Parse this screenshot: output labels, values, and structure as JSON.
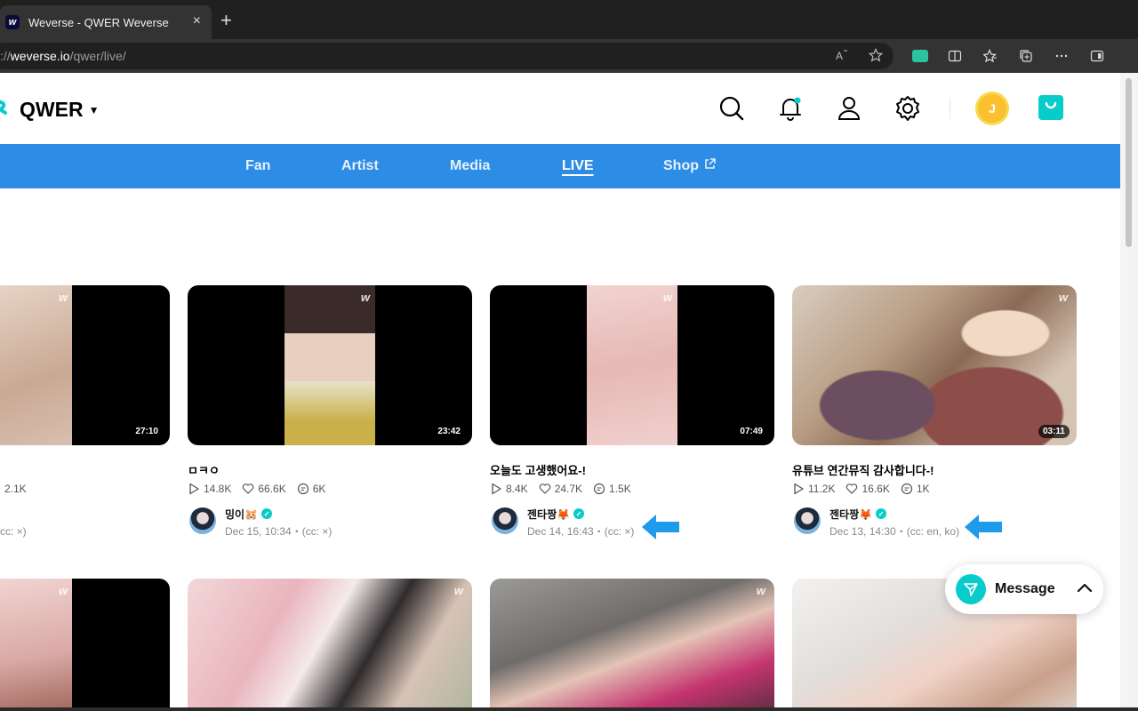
{
  "browser": {
    "tab_title": "Weverse - QWER Weverse",
    "tab_favicon": "w",
    "tab_close": "×",
    "new_tab": "+",
    "url_scheme": "://",
    "url_host": "weverse.io",
    "url_path": "/qwer/live/",
    "icons": [
      "read-aloud-icon",
      "favorite-star-icon",
      "extension-icon",
      "split-screen-icon",
      "favorites-icon",
      "collections-icon",
      "more-icon",
      "sidebar-icon"
    ]
  },
  "header": {
    "community_name": "QWER",
    "jelly_label": "J"
  },
  "nav": {
    "items": [
      {
        "label": "Fan"
      },
      {
        "label": "Artist"
      },
      {
        "label": "Media"
      },
      {
        "label": "LIVE"
      },
      {
        "label": "Shop"
      }
    ]
  },
  "row1": [
    {
      "title": "",
      "plays": "",
      "likes": "",
      "comments": "2.1K",
      "author": "",
      "date": "cc: ×)",
      "duration": "27:10"
    },
    {
      "title": "ㅁㅋㅇ",
      "plays": "14.8K",
      "likes": "66.6K",
      "comments": "6K",
      "author": "밍이🐹",
      "date": "Dec 15, 10:34・(cc: ×)",
      "duration": "23:42"
    },
    {
      "title": "오늘도 고생했어요-!",
      "plays": "8.4K",
      "likes": "24.7K",
      "comments": "1.5K",
      "author": "젠타짱🦊",
      "date": "Dec 14, 16:43・(cc: ×)",
      "duration": "07:49"
    },
    {
      "title": "유튜브 연간뮤직 감사합니다-!",
      "plays": "11.2K",
      "likes": "16.6K",
      "comments": "1K",
      "author": "젠타짱🦊",
      "date": "Dec 13, 14:30・(cc: en, ko)",
      "duration": "03:11"
    }
  ],
  "watermark": "w",
  "message_button": {
    "label": "Message"
  },
  "colors": {
    "nav_bg": "#2d8ce6",
    "accent": "#08ccca",
    "arrow": "#1e9bea"
  }
}
